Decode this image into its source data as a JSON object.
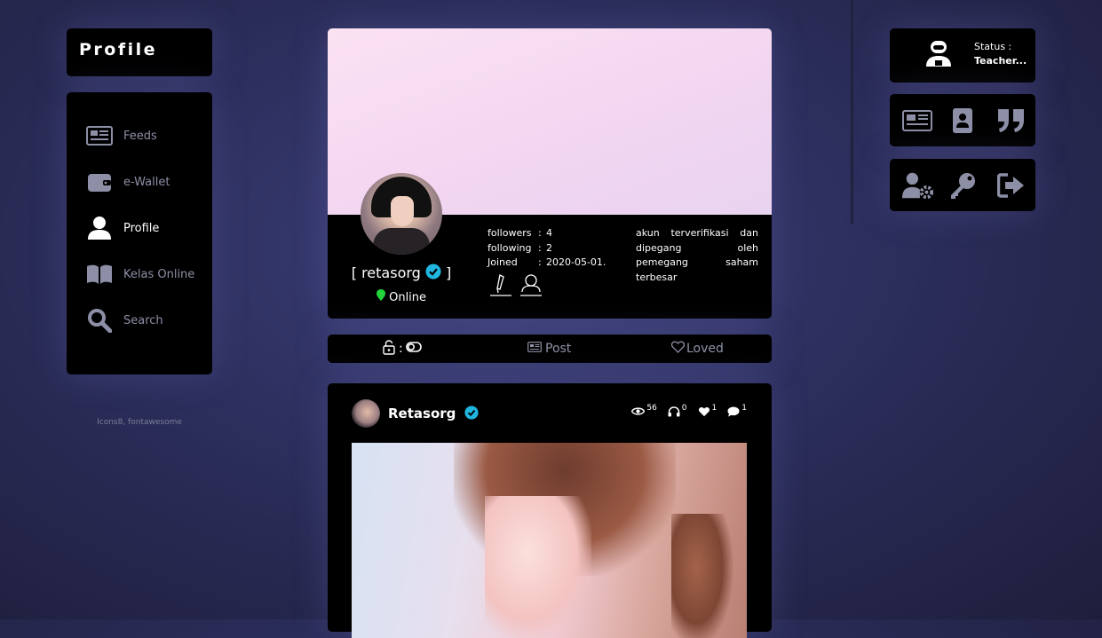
{
  "sidebar": {
    "title": "Profile",
    "items": [
      {
        "label": "Feeds",
        "icon": "newspaper-icon"
      },
      {
        "label": "e-Wallet",
        "icon": "wallet-icon"
      },
      {
        "label": "Profile",
        "icon": "user-icon",
        "active": true
      },
      {
        "label": "Kelas Online",
        "icon": "book-icon"
      },
      {
        "label": "Search",
        "icon": "search-icon"
      }
    ],
    "credits": "Icons8, fontawesome"
  },
  "profile": {
    "username": "[ retasorg",
    "bracket_close": "]",
    "status": "Online",
    "stats": [
      {
        "key": "followers",
        "sep": ":",
        "value": "4"
      },
      {
        "key": "following",
        "sep": ":",
        "value": "2"
      },
      {
        "key": "Joined",
        "sep": ":",
        "value": "2020-05-01."
      }
    ],
    "about": "akun terverifikasi dan dipegang oleh pemegang saham terbesar"
  },
  "tabs": {
    "lock_sep": ":",
    "post": "Post",
    "loved": "Loved"
  },
  "post": {
    "author": "Retasorg",
    "views": "56",
    "listens": "0",
    "likes": "1",
    "comments": "1"
  },
  "status": {
    "label": "Status :",
    "value": "Teacher..."
  },
  "colors": {
    "accent_verified": "#1fb6e0",
    "online": "#22d33a",
    "panel": "#000000"
  }
}
